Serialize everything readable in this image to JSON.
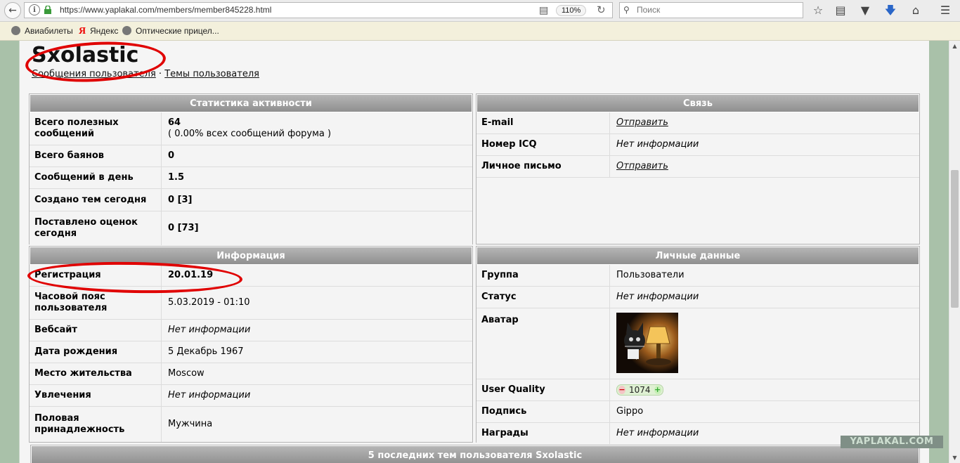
{
  "browser": {
    "url": "https://www.yaplakal.com/members/member845228.html",
    "zoom": "110%",
    "search_placeholder": "Поиск",
    "bookmarks": [
      "Авиабилеты",
      "Яндекс",
      "Оптические прицел..."
    ]
  },
  "profile": {
    "username": "Sxolastic",
    "links": [
      "Сообщения пользователя",
      "Темы пользователя"
    ],
    "link_separator": "·"
  },
  "stats": {
    "title": "Статистика активности",
    "rows": [
      {
        "label": "Всего полезных сообщений",
        "value": "64",
        "value2": "( 0.00% всех сообщений форума )"
      },
      {
        "label": "Всего баянов",
        "value": "0"
      },
      {
        "label": "Сообщений в день",
        "value": "1.5"
      },
      {
        "label": "Создано тем сегодня",
        "value": "0 [3]"
      },
      {
        "label": "Поставлено оценок сегодня",
        "value": "0 [73]"
      }
    ]
  },
  "contact": {
    "title": "Связь",
    "rows": [
      {
        "label": "E-mail",
        "value": "Отправить"
      },
      {
        "label": "Номер ICQ",
        "value": "Нет информации"
      },
      {
        "label": "Личное письмо",
        "value": "Отправить"
      }
    ]
  },
  "info": {
    "title": "Информация",
    "rows": [
      {
        "label": "Регистрация",
        "value": "20.01.19"
      },
      {
        "label": "Часовой пояс пользователя",
        "value": "5.03.2019 - 01:10"
      },
      {
        "label": "Вебсайт",
        "value": "Нет информации"
      },
      {
        "label": "Дата рождения",
        "value": "5 Декабрь 1967"
      },
      {
        "label": "Место жительства",
        "value": "Moscow"
      },
      {
        "label": "Увлечения",
        "value": "Нет информации"
      },
      {
        "label": "Половая принадлежность",
        "value": "Мужчина"
      }
    ]
  },
  "personal": {
    "title": "Личные данные",
    "rows": [
      {
        "label": "Группа",
        "value": "Пользователи"
      },
      {
        "label": "Статус",
        "value": "Нет информации"
      },
      {
        "label": "Аватар"
      },
      {
        "label": "User Quality",
        "value": "1074",
        "minus": "−",
        "plus": "+"
      },
      {
        "label": "Подпись",
        "value": "Gippo"
      },
      {
        "label": "Награды",
        "value": "Нет информации"
      }
    ]
  },
  "last_topics_title": "5 последних тем пользователя Sxolastic",
  "watermark": "YAPLAKAL.COM",
  "colors": {
    "annotation": "#e00000",
    "header_bg": "#9f9f9f",
    "side_bg": "#a9c1a9"
  }
}
